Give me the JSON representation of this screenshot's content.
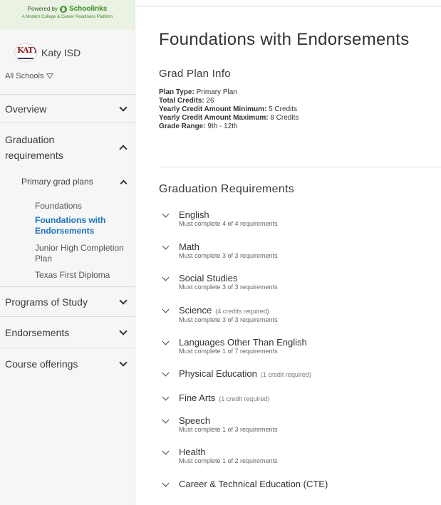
{
  "sidebar": {
    "powered_by": "Powered by",
    "brand": "Schoolinks",
    "tagline": "A Modern College & Career Readiness Platform",
    "district_logo_text": "KATY",
    "district_name": "Katy ISD",
    "school_filter": "All Schools",
    "nav": {
      "overview": "Overview",
      "graduation_requirements": "Graduation requirements",
      "primary_grad_plans": "Primary grad plans",
      "plans": [
        "Foundations",
        "Foundations with Endorsements",
        "Junior High Completion Plan",
        "Texas First Diploma"
      ],
      "active_plan_index": 1,
      "programs_of_study": "Programs of Study",
      "endorsements": "Endorsements",
      "course_offerings": "Course offerings"
    }
  },
  "main": {
    "title": "Foundations with Endorsements",
    "plan_info_title": "Grad Plan Info",
    "plan_info": [
      {
        "label": "Plan Type:",
        "value": "Primary Plan"
      },
      {
        "label": "Total Credits:",
        "value": "26"
      },
      {
        "label": "Yearly Credit Amount Minimum:",
        "value": "5 Credits"
      },
      {
        "label": "Yearly Credit Amount Maximum:",
        "value": "8 Credits"
      },
      {
        "label": "Grade Range:",
        "value": "9th - 12th"
      }
    ],
    "requirements_title": "Graduation Requirements",
    "requirements": [
      {
        "name": "English",
        "note": "",
        "detail": "Must complete 4 of 4 requirements"
      },
      {
        "name": "Math",
        "note": "",
        "detail": "Must complete 3 of 3 requirements"
      },
      {
        "name": "Social Studies",
        "note": "",
        "detail": "Must complete 3 of 3 requirements"
      },
      {
        "name": "Science",
        "note": "(4 credits required)",
        "detail": "Must complete 3 of 3 requirements"
      },
      {
        "name": "Languages Other Than English",
        "note": "",
        "detail": "Must complete 1 of 7 requirements"
      },
      {
        "name": "Physical Education",
        "note": "(1 credit required)",
        "detail": ""
      },
      {
        "name": "Fine Arts",
        "note": "(1 credit required)",
        "detail": ""
      },
      {
        "name": "Speech",
        "note": "",
        "detail": "Must complete 1 of 3 requirements"
      },
      {
        "name": "Health",
        "note": "",
        "detail": "Must complete 1 of 2 requirements"
      },
      {
        "name": "Career & Technical Education (CTE)",
        "note": "",
        "detail": ""
      }
    ]
  }
}
